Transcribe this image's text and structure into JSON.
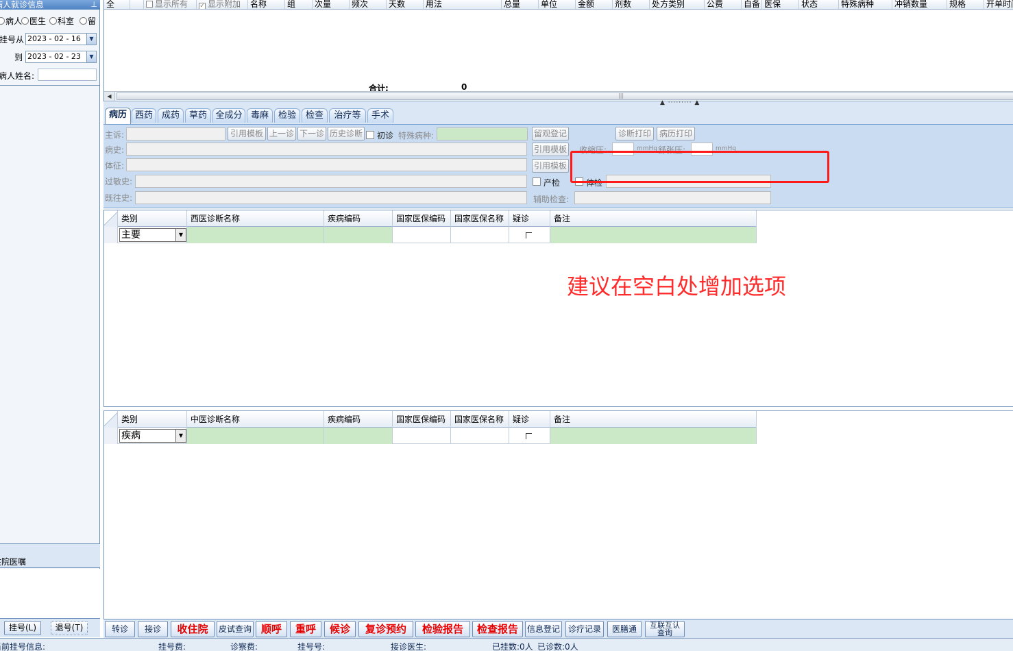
{
  "left_panel": {
    "title": "病人就诊信息",
    "pin_icon": "pin-icon",
    "radios": [
      "病人",
      "医生",
      "科室",
      "留"
    ],
    "date_from_label": "挂号从",
    "date_from": "2023 - 02 - 16",
    "date_to_label": "到",
    "date_to": "2023 - 02 - 23",
    "patient_name_label": "病人姓名:",
    "patient_name_value": "",
    "section2_title": "住院医嘱",
    "register_button": "挂号(L)",
    "unregister_button": "退号(T)"
  },
  "top_grid": {
    "col_all": "全",
    "show_all": "显示所有",
    "show_extra": "显示附加",
    "columns": [
      "名称",
      "组",
      "次量",
      "频次",
      "天数",
      "用法",
      "总量",
      "单位",
      "金额",
      "剂数",
      "处方类别",
      "公费",
      "自备",
      "医保",
      "状态",
      "特殊病种",
      "冲销数量",
      "规格",
      "开单时间"
    ],
    "total_label": "合计:",
    "total_value": "0"
  },
  "tabs": [
    "病历",
    "西药",
    "成药",
    "草药",
    "全成分",
    "毒麻",
    "检验",
    "检查",
    "治疗等",
    "手术"
  ],
  "form": {
    "chief_complaint": "主诉:",
    "history": "病史:",
    "signs": "体征:",
    "allergy": "过敏史:",
    "past_history": "既往史:",
    "btn_template": "引用模板",
    "btn_prev": "上一诊",
    "btn_next": "下一诊",
    "btn_hist_diag": "历史诊断",
    "first_visit": "初诊",
    "special_disease": "特殊病种:",
    "btn_observe": "留观登记",
    "btn_diag_print": "诊断打印",
    "btn_record_print": "病历打印",
    "systolic": "收缩压:",
    "diastolic": "舒张压:",
    "mmhg": "mmHg",
    "prenatal": "产检",
    "physical": "体检",
    "aux_exam": "辅助检查:"
  },
  "western_diag": {
    "columns": [
      "类别",
      "西医诊断名称",
      "疾病编码",
      "国家医保编码",
      "国家医保名称",
      "疑诊",
      "备注"
    ],
    "row_type": "主要"
  },
  "annotation": "建议在空白处增加选项",
  "tcm_diag": {
    "columns": [
      "类别",
      "中医诊断名称",
      "疾病编码",
      "国家医保编码",
      "国家医保名称",
      "疑诊",
      "备注"
    ],
    "row_type": "疾病"
  },
  "toolbar": {
    "buttons": [
      "转诊",
      "接诊",
      "收住院",
      "皮试查询",
      "顺呼",
      "重呼",
      "候诊",
      "复诊预约",
      "检验报告",
      "检查报告",
      "信息登记",
      "诊疗记录",
      "医膳通"
    ],
    "last_line1": "互联互认",
    "last_line2": "查询"
  },
  "status_bar": {
    "current_reg": "当前挂号信息:",
    "reg_fee": "挂号费:",
    "exam_fee": "诊察费:",
    "reg_no": "挂号号:",
    "doctor": "接诊医生:",
    "registered": "已挂数:0人",
    "visited": "已诊数:0人"
  }
}
